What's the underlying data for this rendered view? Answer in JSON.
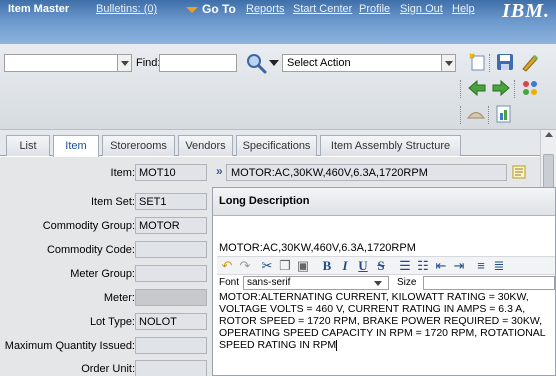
{
  "header": {
    "app_title": "Item Master",
    "bulletins": "Bulletins: (0)",
    "goto": "Go To",
    "reports": "Reports",
    "start_center": "Start Center",
    "profile": "Profile",
    "sign_out": "Sign Out",
    "help": "Help",
    "logo": "IBM."
  },
  "toolbar": {
    "find_label": "Find:",
    "find_value": "",
    "select_action": "Select Action"
  },
  "tabs": [
    "List",
    "Item",
    "Storerooms",
    "Vendors",
    "Specifications",
    "Item Assembly Structure"
  ],
  "active_tab": "Item",
  "form": {
    "item_label": "Item:",
    "item_value": "MOT10",
    "itemset_label": "Item Set:",
    "itemset_value": "SET1",
    "commodity_group_label": "Commodity Group:",
    "commodity_group_value": "MOTOR",
    "commodity_code_label": "Commodity Code:",
    "meter_group_label": "Meter Group:",
    "meter_label": "Meter:",
    "lot_type_label": "Lot Type:",
    "lot_type_value": "NOLOT",
    "max_qty_label": "Maximum Quantity Issued:",
    "order_unit_label": "Order Unit:",
    "description": "MOTOR:AC,30KW,460V,6.3A,1720RPM"
  },
  "long_description": {
    "header": "Long Description",
    "title_text": "MOTOR:AC,30KW,460V,6.3A,1720RPM",
    "font_label": "Font",
    "font_value": "sans-serif",
    "size_label": "Size",
    "body": "MOTOR:ALTERNATING CURRENT, KILOWATT RATING = 30KW, VOLTAGE VOLTS = 460 V, CURRENT RATING IN AMPS = 6.3 A, ROTOR SPEED = 1720 RPM, BRAKE POWER REQUIRED = 30KW, OPERATING SPEED CAPACITY IN RPM = 1720 RPM, ROTATIONAL SPEED RATING IN RPM"
  },
  "colors": {
    "header_blue": "#3f6fa8",
    "tab_active_text": "#1a4f9a",
    "go_to_arrow": "#f0a020"
  }
}
